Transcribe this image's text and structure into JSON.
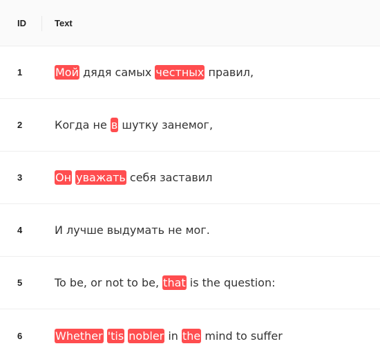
{
  "header": {
    "id_label": "ID",
    "text_label": "Text"
  },
  "colors": {
    "highlight": "#ff4d4f",
    "highlight_text": "#ffffff"
  },
  "rows": [
    {
      "id": "1",
      "segments": [
        {
          "text": "Мой",
          "hl": true
        },
        {
          "text": " дядя самых ",
          "hl": false
        },
        {
          "text": "честных",
          "hl": true
        },
        {
          "text": " правил,",
          "hl": false
        }
      ]
    },
    {
      "id": "2",
      "segments": [
        {
          "text": "Когда не ",
          "hl": false
        },
        {
          "text": "в",
          "hl": true
        },
        {
          "text": " шутку занемог,",
          "hl": false
        }
      ]
    },
    {
      "id": "3",
      "segments": [
        {
          "text": "Он",
          "hl": true
        },
        {
          "text": " ",
          "hl": false
        },
        {
          "text": "уважать",
          "hl": true
        },
        {
          "text": " себя заставил",
          "hl": false
        }
      ]
    },
    {
      "id": "4",
      "segments": [
        {
          "text": "И лучше выдумать не мог.",
          "hl": false
        }
      ]
    },
    {
      "id": "5",
      "segments": [
        {
          "text": "To be, or not to be, ",
          "hl": false
        },
        {
          "text": "that",
          "hl": true
        },
        {
          "text": " is the question:",
          "hl": false
        }
      ]
    },
    {
      "id": "6",
      "segments": [
        {
          "text": "Whether",
          "hl": true
        },
        {
          "text": " ",
          "hl": false
        },
        {
          "text": "'tis",
          "hl": true
        },
        {
          "text": " ",
          "hl": false
        },
        {
          "text": "nobler",
          "hl": true
        },
        {
          "text": " in ",
          "hl": false
        },
        {
          "text": "the",
          "hl": true
        },
        {
          "text": " mind to suffer",
          "hl": false
        }
      ]
    }
  ]
}
